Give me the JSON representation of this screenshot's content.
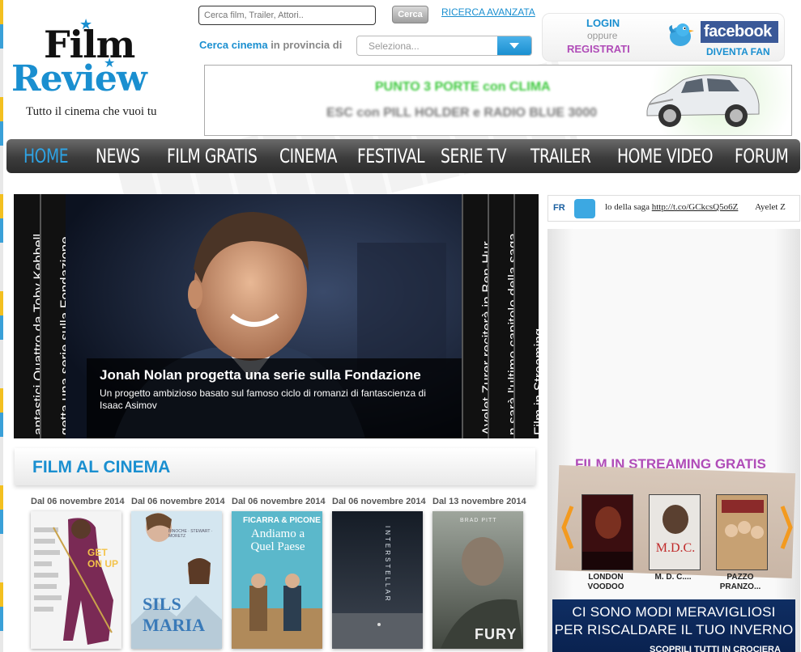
{
  "logo": {
    "line1": "Film",
    "line2": "Review",
    "tagline": "Tutto il cinema che vuoi tu"
  },
  "search": {
    "placeholder": "Cerca film, Trailer, Attori..",
    "button": "Cerca",
    "advanced": "RICERCA AVANZATA"
  },
  "cinema_search": {
    "label_part1": "Cerca cinema",
    "label_part2": "in provincia di",
    "select_value": "Seleziona..."
  },
  "account": {
    "login": "LOGIN",
    "or": "oppure",
    "register": "REGISTRATI",
    "facebook": "facebook",
    "fan": "DIVENTA FAN"
  },
  "top_ad": {
    "line1": "PUNTO 3 PORTE con CLIMA",
    "line2": "ESC con PILL HOLDER e RADIO BLUE 3000"
  },
  "nav": [
    "HOME",
    "NEWS",
    "FILM GRATIS",
    "CINEMA",
    "FESTIVAL",
    "SERIE TV",
    "TRAILER",
    "HOME VIDEO",
    "FORUM"
  ],
  "hero": {
    "title": "Jonah Nolan progetta una serie sulla Fondazione",
    "description": "Un progetto ambizioso basato sul famoso ciclo di romanzi di fantascienza di Isaac Asimov",
    "tabs": [
      "antastici Quattro da Toby Kebbell",
      "getta una serie sulla Fondazione",
      "Ayelet Zurer reciterà in Ben-Hur",
      "n sarà l'ultimo capitolo della saga",
      "Film in Streaming"
    ]
  },
  "film_section": {
    "title": "FILM AL CINEMA",
    "dates": [
      "Dal 06 novembre 2014",
      "Dal 06 novembre 2014",
      "Dal 06 novembre 2014",
      "Dal 06 novembre 2014",
      "Dal 13 novembre 2014"
    ],
    "poster_texts": [
      "GET ON UP",
      "SILS MARIA",
      "Andiamo a Quel Paese",
      "INTERSTELLAR",
      "FURY"
    ],
    "poster_subtexts": [
      "",
      "BINOCHE · STEWART · MORETZ",
      "FICARRA & PICONE",
      "",
      "BRAD PITT"
    ]
  },
  "twitter": {
    "logo": "FR",
    "text_before": "lo della saga ",
    "link": "http://t.co/GCkcsQ5o6Z",
    "text_after": "Ayelet Z"
  },
  "streaming": {
    "title": "FILM IN STREAMING GRATIS",
    "films": [
      "LONDON VOODOO",
      "M. D. C....",
      "PAZZO PRANZO..."
    ]
  },
  "bottom_ad": {
    "line1": "CI SONO MODI MERAVIGLIOSI",
    "line2": "PER RISCALDARE IL TUO INVERNO",
    "line3": "SCOPRILI TUTTI IN CROCIERA"
  },
  "colors": {
    "accent": "#1a8fd0",
    "purple": "#b04cb8",
    "nav_bg": "#3c3c3c"
  }
}
